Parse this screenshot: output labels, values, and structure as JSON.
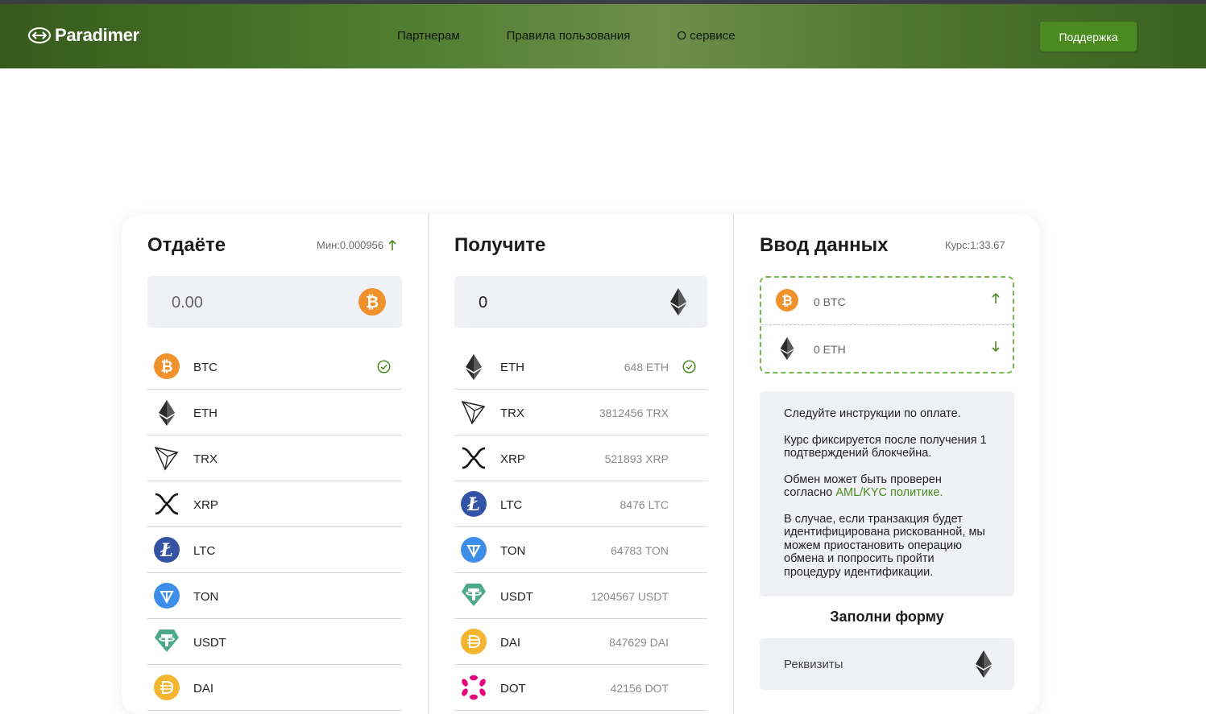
{
  "header": {
    "logo_text": "Paradimer",
    "nav": [
      "Партнерам",
      "Правила пользования",
      "О сервисе"
    ],
    "support_label": "Поддержка"
  },
  "colors": {
    "accent": "#4a8a1f",
    "header_dark": "#365a1c",
    "btc": "#f0922c",
    "ltc": "#3453a5",
    "ton": "#3c8ee8",
    "usdt": "#4ea98c",
    "dai": "#f4b631",
    "dot": "#e6007a"
  },
  "give": {
    "title": "Отдаёте",
    "min_label": "Мин:0.000956",
    "amount": "0.00",
    "coin": "btc-icon",
    "list": [
      {
        "ticker": "BTC",
        "icon": "btc-icon",
        "selected": true
      },
      {
        "ticker": "ETH",
        "icon": "eth-icon",
        "selected": false
      },
      {
        "ticker": "TRX",
        "icon": "trx-icon",
        "selected": false
      },
      {
        "ticker": "XRP",
        "icon": "xrp-icon",
        "selected": false
      },
      {
        "ticker": "LTC",
        "icon": "ltc-icon",
        "selected": false
      },
      {
        "ticker": "TON",
        "icon": "ton-icon",
        "selected": false
      },
      {
        "ticker": "USDT",
        "icon": "usdt-icon",
        "selected": false
      },
      {
        "ticker": "DAI",
        "icon": "dai-icon",
        "selected": false
      }
    ]
  },
  "receive": {
    "title": "Получите",
    "amount": "0",
    "coin": "eth-icon",
    "list": [
      {
        "ticker": "ETH",
        "reserve": "648 ETH",
        "icon": "eth-icon",
        "selected": true
      },
      {
        "ticker": "TRX",
        "reserve": "3812456 TRX",
        "icon": "trx-icon",
        "selected": false
      },
      {
        "ticker": "XRP",
        "reserve": "521893 XRP",
        "icon": "xrp-icon",
        "selected": false
      },
      {
        "ticker": "LTC",
        "reserve": "8476 LTC",
        "icon": "ltc-icon",
        "selected": false
      },
      {
        "ticker": "TON",
        "reserve": "64783 TON",
        "icon": "ton-icon",
        "selected": false
      },
      {
        "ticker": "USDT",
        "reserve": "1204567 USDT",
        "icon": "usdt-icon",
        "selected": false
      },
      {
        "ticker": "DAI",
        "reserve": "847629 DAI",
        "icon": "dai-icon",
        "selected": false
      },
      {
        "ticker": "DOT",
        "reserve": "42156 DOT",
        "icon": "dot-icon",
        "selected": false
      }
    ]
  },
  "details": {
    "title": "Ввод данных",
    "rate_label": "Курс:1:33.67",
    "give_value": "0 BTC",
    "receive_value": "0 ETH",
    "info": {
      "p1": "Следуйте инструкции по оплате.",
      "p2": "Курс фиксируется после получения 1 подтверждений блокчейна.",
      "p3_prefix": "Обмен может быть проверен согласно ",
      "p3_link": "AML/KYC политике.",
      "p4": "В случае, если транзакция будет идентифицирована рискованной, мы можем приостановить операцию обмена и попросить пройти процедуру идентификации."
    },
    "form_title": "Заполни форму",
    "requisites_placeholder": "Реквизиты"
  }
}
